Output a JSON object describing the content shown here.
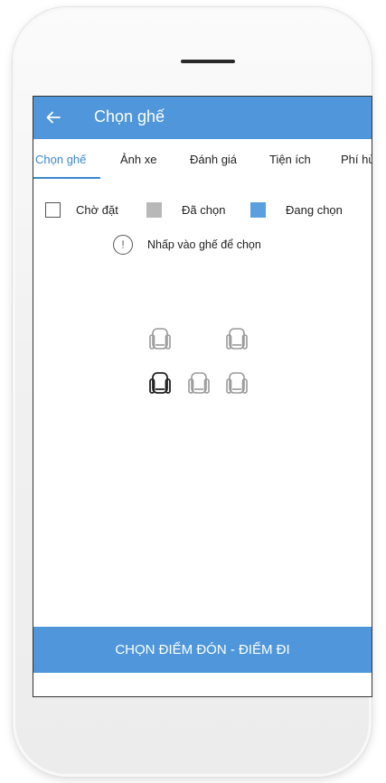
{
  "appbar": {
    "title": "Chọn ghế"
  },
  "tabs": [
    {
      "label": "Chọn ghế"
    },
    {
      "label": "Ảnh xe"
    },
    {
      "label": "Đánh giá"
    },
    {
      "label": "Tiện ích"
    },
    {
      "label": "Phí hủy"
    }
  ],
  "legend": [
    {
      "label": "Chờ đặt",
      "color": "#ffffff"
    },
    {
      "label": "Đã chọn",
      "color": "#b8b8b8"
    },
    {
      "label": "Đang chọn",
      "color": "#5a9fe0"
    }
  ],
  "hint": {
    "icon": "!",
    "text": "Nhấp vào ghế để chọn"
  },
  "seats": [
    {
      "status": "booked"
    },
    {
      "status": "booked"
    },
    {
      "status": "available"
    },
    {
      "status": "booked"
    },
    {
      "status": "booked"
    }
  ],
  "footer": {
    "button_label": "CHỌN ĐIỂM ĐÓN - ĐIỂM ĐI"
  },
  "colors": {
    "primary": "#4f97da",
    "tab_active": "#3a86d0",
    "seat_booked": "#9a9a9a",
    "seat_available": "#222222"
  }
}
